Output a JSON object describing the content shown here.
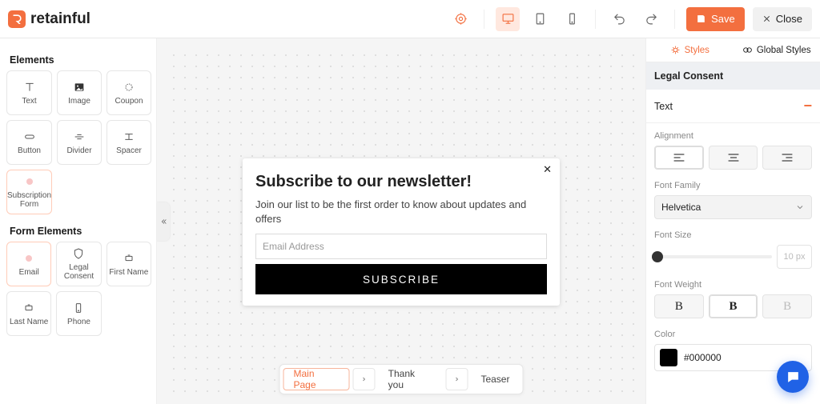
{
  "brand": {
    "name": "retainful"
  },
  "header": {
    "save_label": "Save",
    "close_label": "Close"
  },
  "sidebar": {
    "section_elements": "Elements",
    "section_form": "Form Elements",
    "elements": [
      {
        "label": "Text"
      },
      {
        "label": "Image"
      },
      {
        "label": "Coupon"
      },
      {
        "label": "Button"
      },
      {
        "label": "Divider"
      },
      {
        "label": "Spacer"
      },
      {
        "label": "Subscription Form"
      }
    ],
    "form_elements": [
      {
        "label": "Email"
      },
      {
        "label": "Legal Consent"
      },
      {
        "label": "First Name"
      },
      {
        "label": "Last Name"
      },
      {
        "label": "Phone"
      }
    ]
  },
  "popup": {
    "title": "Subscribe to our newsletter!",
    "subtitle": "Join our list to be the first order to know about updates and offers",
    "email_placeholder": "Email Address",
    "subscribe_label": "SUBSCRIBE"
  },
  "pages": {
    "items": [
      "Main Page",
      "Thank you",
      "Teaser"
    ],
    "active_index": 0
  },
  "right": {
    "tab_styles": "Styles",
    "tab_global": "Global Styles",
    "panel_title": "Legal Consent",
    "accordion_text": "Text",
    "alignment_label": "Alignment",
    "font_family_label": "Font Family",
    "font_family_value": "Helvetica",
    "font_size_label": "Font Size",
    "font_size_value": "10 px",
    "font_weight_label": "Font Weight",
    "weight_opts": [
      "B",
      "B",
      "B"
    ],
    "color_label": "Color",
    "color_value": "#000000"
  }
}
